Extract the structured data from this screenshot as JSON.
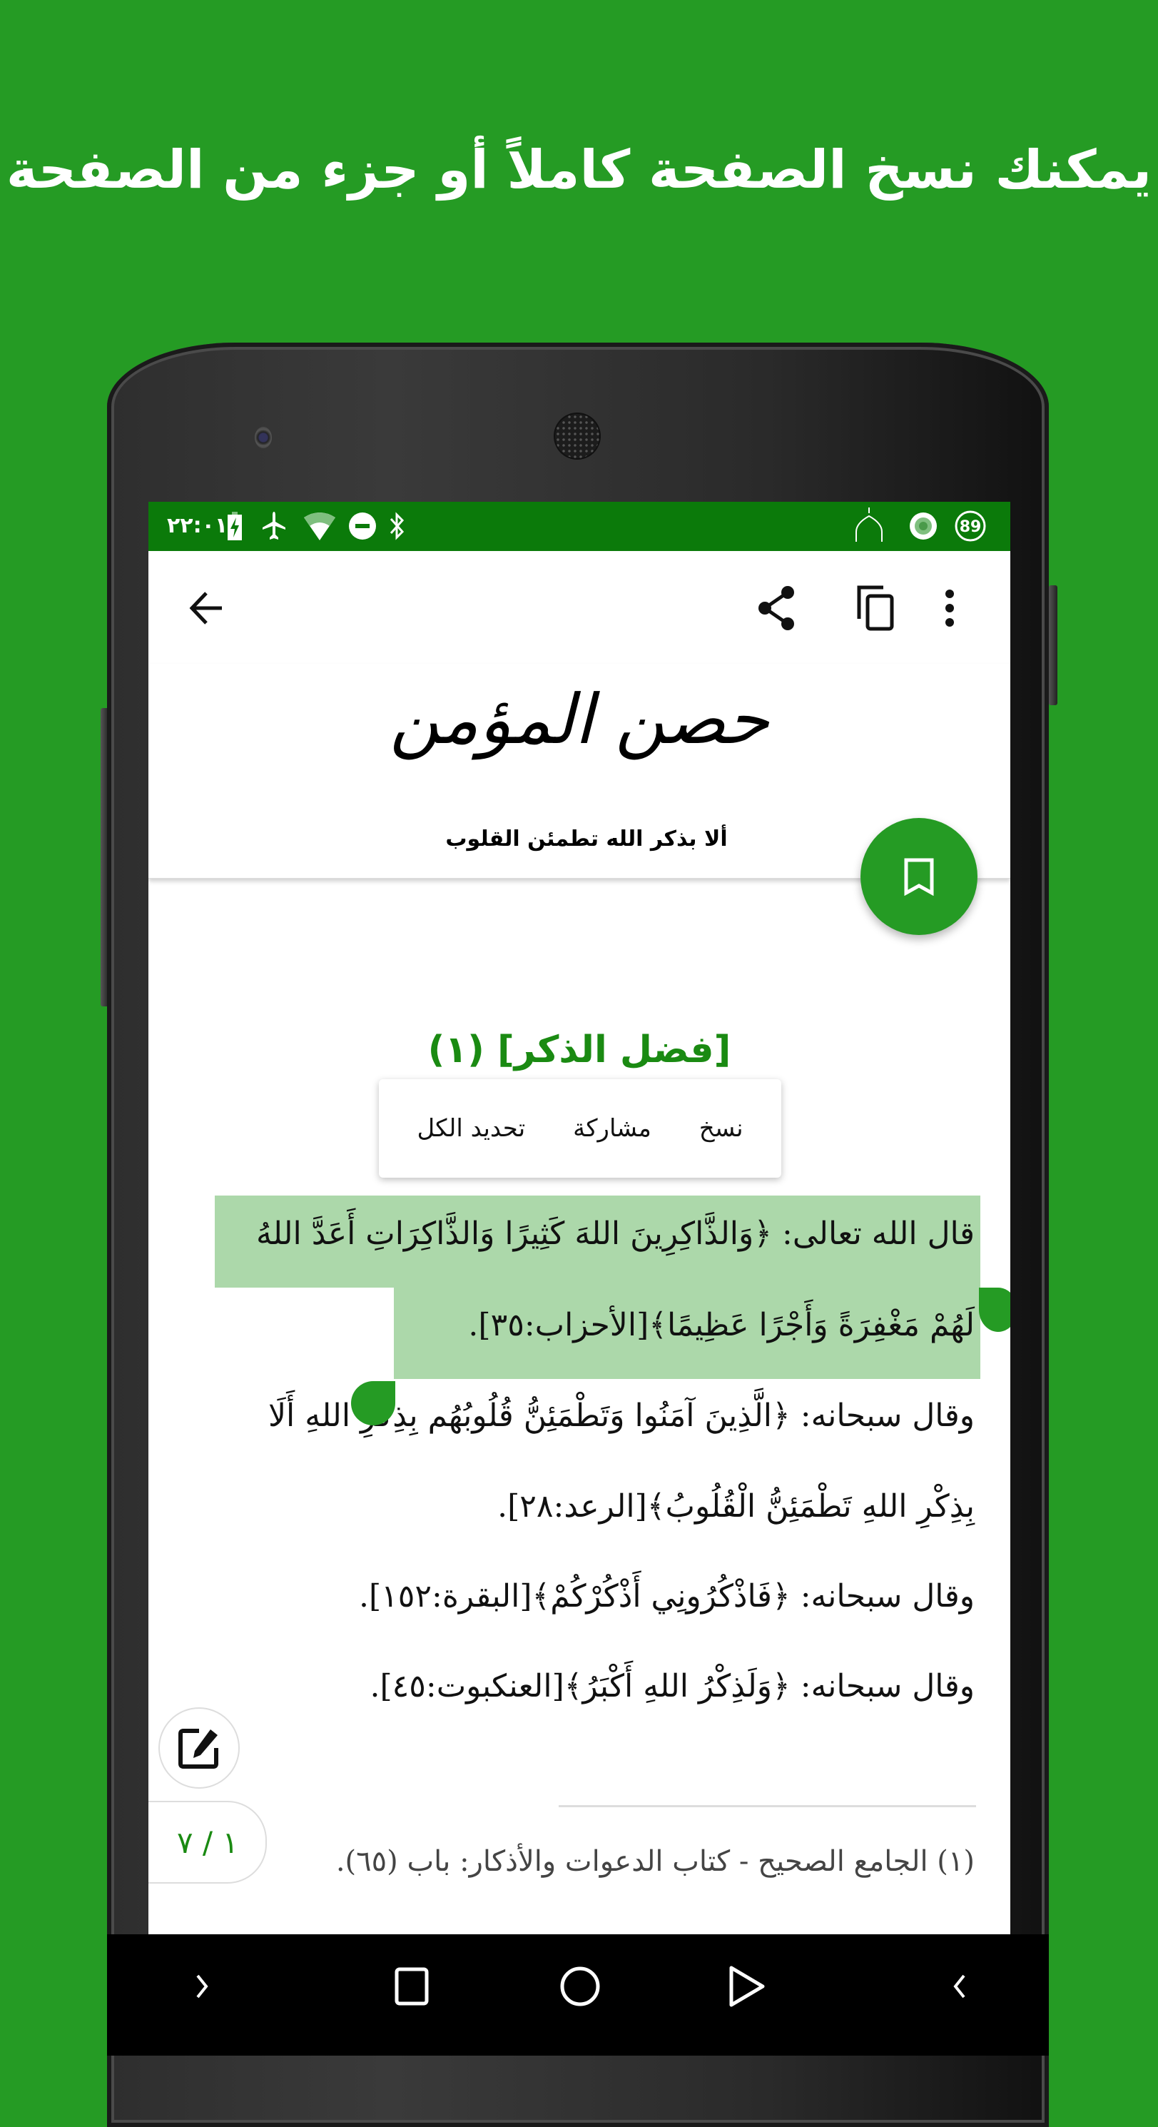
{
  "headline": "يمكنك نسخ الصفحة كاملاً أو جزء من الصفحة",
  "colors": {
    "background": "#259b24",
    "status_bar": "#0b7a0a",
    "accent": "#259b24",
    "title": "#1a8a12",
    "selection": "#acd8aa"
  },
  "status_bar": {
    "time": "٢٢:٠١",
    "left_icons": [
      "battery-charging-icon",
      "airplane-mode-icon",
      "wifi-icon",
      "do-not-disturb-icon",
      "bluetooth-icon"
    ],
    "right_icons": [
      "mosque-icon",
      "record-icon",
      "notification-count-icon"
    ],
    "notification_count": "89"
  },
  "app_bar": {
    "back_icon": "arrow-back-icon",
    "actions": [
      "share-icon",
      "copy-icon",
      "more-vert-icon"
    ]
  },
  "header": {
    "logo_text": "حصن المؤمن",
    "tagline": "ألا بذكر الله تطمئن القلوب"
  },
  "fab": {
    "icon": "bookmark-icon"
  },
  "content": {
    "section_title": "[فضل الذكر] (١)",
    "popup_menu": [
      "تحديد الكل",
      "مشاركة",
      "نسخ"
    ],
    "lines": [
      "قال الله تعالى: ﴿وَالذَّاكِرِينَ اللهَ كَثِيرًا وَالذَّاكِرَاتِ أَعَدَّ اللهُ",
      "لَهُمْ مَغْفِرَةً وَأَجْرًا عَظِيمًا﴾[الأحزاب:٣٥].",
      "وقال سبحانه: ﴿الَّذِينَ آمَنُوا وَتَطْمَئِنُّ قُلُوبُهُم بِذِكْرِ اللهِ أَلَا",
      "بِذِكْرِ اللهِ تَطْمَئِنُّ الْقُلُوبُ﴾[الرعد:٢٨].",
      "وقال سبحانه: ﴿فَاذْكُرُونِي أَذْكُرْكُمْ﴾[البقرة:١٥٢].",
      "وقال سبحانه: ﴿وَلَذِكْرُ اللهِ أَكْبَرُ﴾[العنكبوت:٤٥]."
    ],
    "footnote": "(١) الجامع الصحيح - كتاب الدعوات والأذكار: باب (٦٥)."
  },
  "page_indicator": "١ / ٧",
  "edit_icon": "edit-note-icon",
  "nav_bar": [
    "chevron-right-icon",
    "recents-icon",
    "home-icon",
    "back-triangle-icon",
    "chevron-left-icon"
  ]
}
